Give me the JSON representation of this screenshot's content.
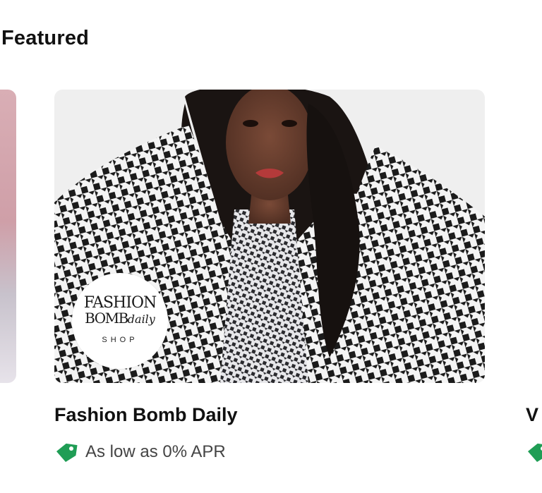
{
  "section": {
    "title": "Featured"
  },
  "featured_card": {
    "store_name": "Fashion Bomb Daily",
    "offer_text": "As low as 0% APR",
    "image_icon": "product-photo",
    "logo": {
      "line1": "FASHION",
      "line2_main": "BOMB",
      "line2_script": "daily",
      "line3": "SHOP"
    }
  },
  "next_card": {
    "store_name_partial": "V"
  },
  "icons": {
    "offer_tag": "tag-icon"
  },
  "colors": {
    "accent_green": "#1f9d55",
    "text_primary": "#111111",
    "text_secondary": "#444444"
  }
}
